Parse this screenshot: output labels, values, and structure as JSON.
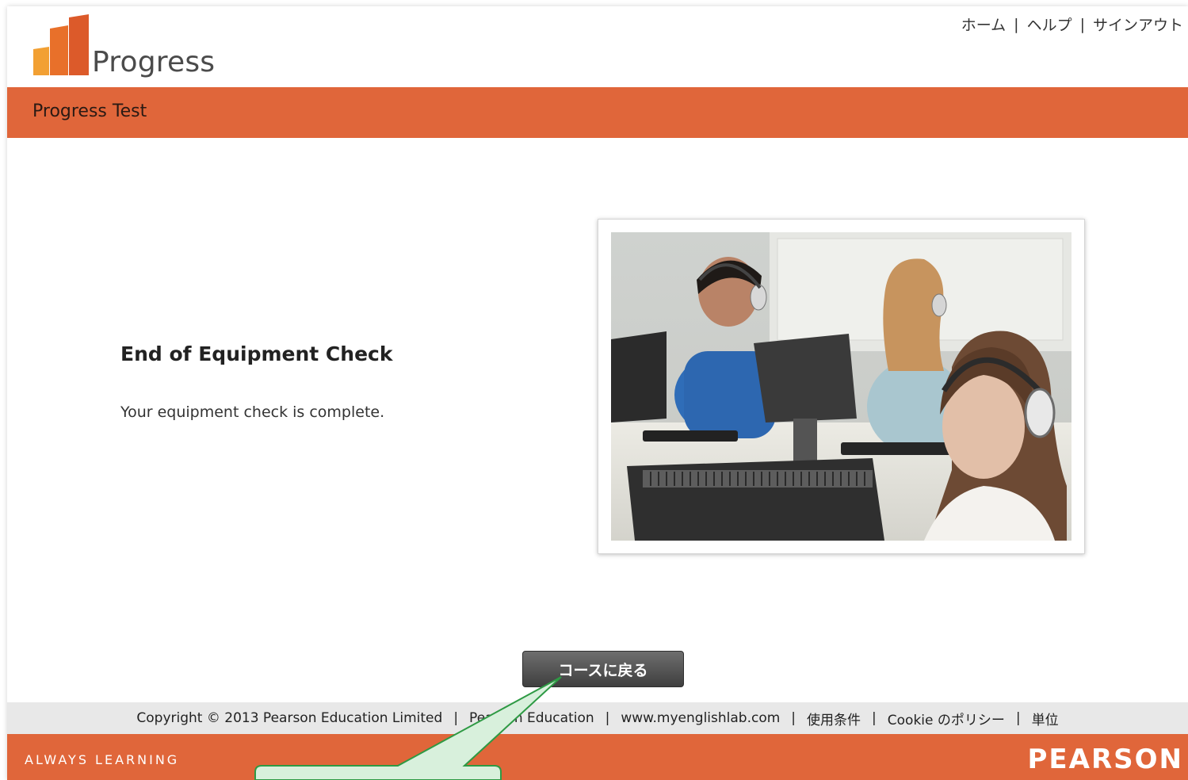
{
  "app": {
    "logo_text": "Progress",
    "page_title": "Progress Test"
  },
  "top_nav": {
    "home": "ホーム",
    "help": "ヘルプ",
    "sign_out": "サインアウト",
    "separator": "|"
  },
  "main": {
    "heading": "End of Equipment Check",
    "message": "Your equipment check is complete.",
    "back_button": "コースに戻る"
  },
  "footer": {
    "copyright": "Copyright © 2013 Pearson Education Limited",
    "links": [
      "Pearson Education",
      "www.myenglishlab.com",
      "使用条件",
      "Cookie のポリシー",
      "単位"
    ],
    "separator": "|",
    "tagline": "ALWAYS LEARNING",
    "brand": "PEARSON"
  },
  "colors": {
    "accent": "#e0663a",
    "button": "#4f4f4f",
    "callout_fill": "#d8f0dc",
    "callout_stroke": "#2e9a44"
  },
  "icons": {
    "logo": "progress-bars-logo"
  }
}
